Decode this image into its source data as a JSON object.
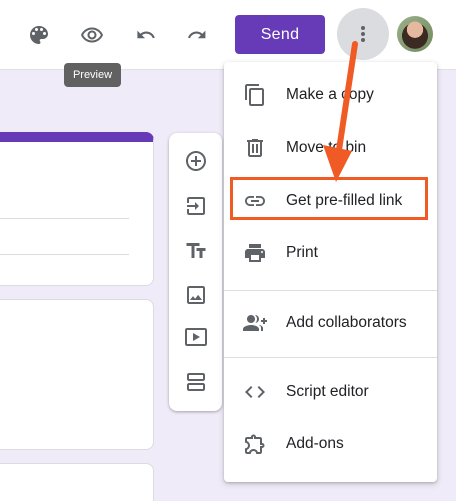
{
  "header": {
    "icons": [
      "palette-icon",
      "eye-icon",
      "undo-icon",
      "redo-icon"
    ],
    "send_label": "Send",
    "more_icon": "more-vert-icon",
    "tooltip": "Preview"
  },
  "side_toolbar": {
    "tools": [
      "add-question-icon",
      "import-questions-icon",
      "add-title-icon",
      "add-image-icon",
      "add-video-icon",
      "add-section-icon"
    ]
  },
  "menu": {
    "items": [
      {
        "label": "Make a copy",
        "icon": "copy-icon"
      },
      {
        "label": "Move to bin",
        "icon": "trash-icon"
      },
      {
        "label": "Get pre-filled link",
        "icon": "link-icon"
      },
      {
        "label": "Print",
        "icon": "print-icon"
      },
      {
        "label": "Add collaborators",
        "icon": "collaborators-icon"
      },
      {
        "label": "Script editor",
        "icon": "code-icon"
      },
      {
        "label": "Add-ons",
        "icon": "puzzle-icon"
      }
    ]
  },
  "colors": {
    "accent": "#673ab7",
    "background": "#f0ebf8",
    "annotation": "#f05a24"
  }
}
